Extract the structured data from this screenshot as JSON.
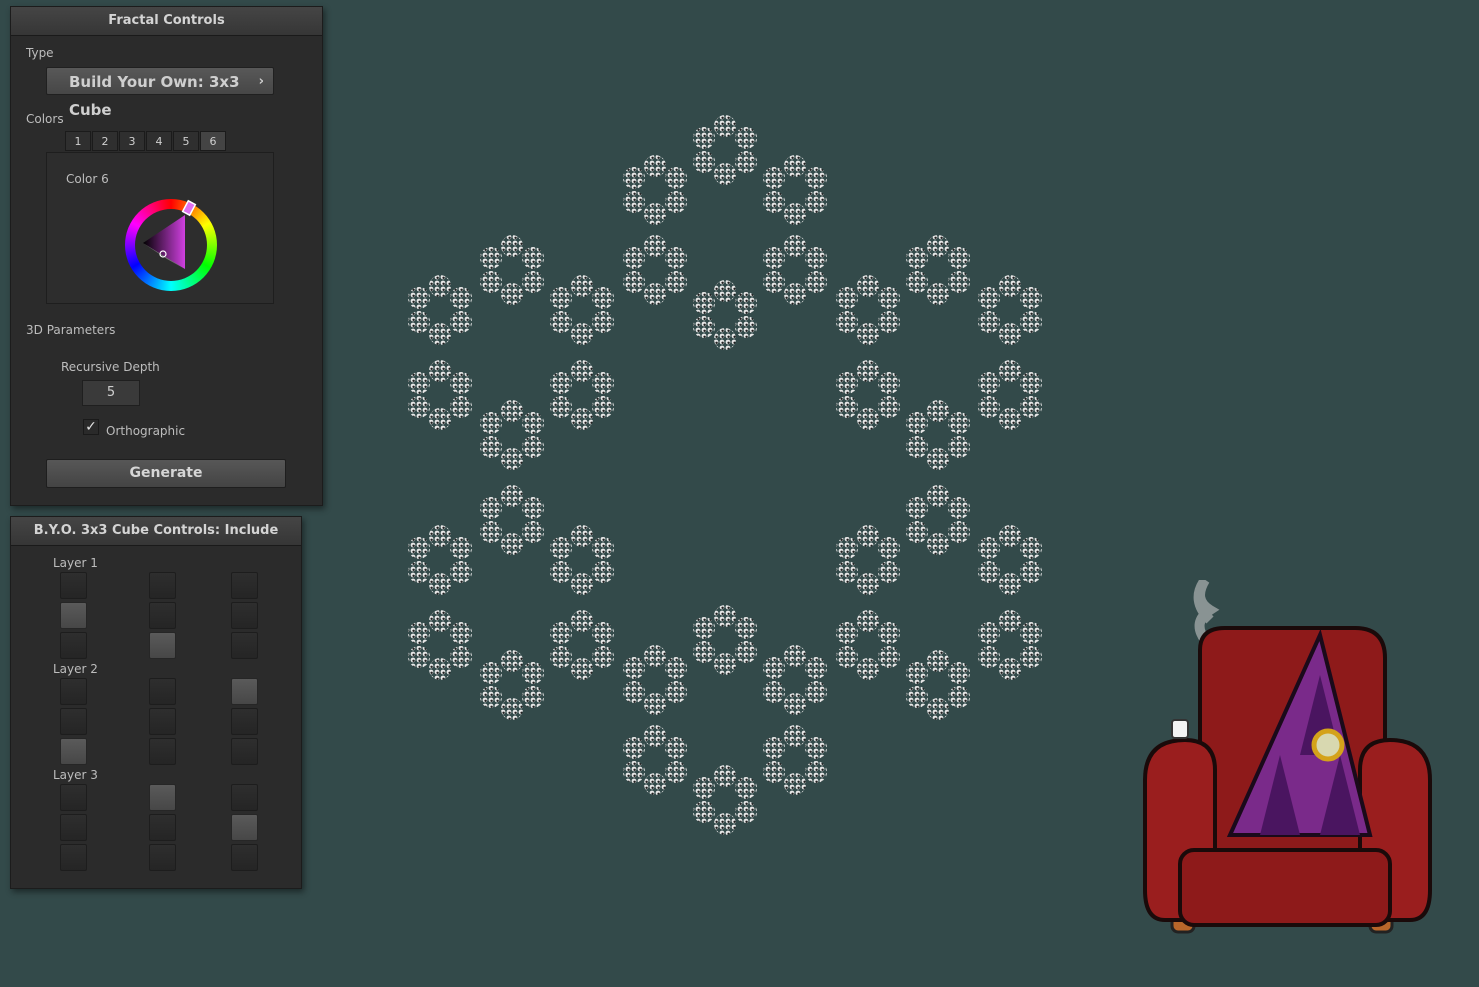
{
  "fractal_controls": {
    "title": "Fractal Controls",
    "type_label": "Type",
    "type_value": "Build Your Own: 3x3 Cube",
    "type_chevron": "›",
    "colors_label": "Colors",
    "color_tabs": [
      "1",
      "2",
      "3",
      "4",
      "5",
      "6"
    ],
    "active_color_tab": "6",
    "color_title": "Color 6",
    "selected_color": "#b03dbb",
    "params_label": "3D Parameters",
    "depth_label": "Recursive Depth",
    "depth_value": "5",
    "ortho_label": "Orthographic",
    "ortho_checked": true,
    "ortho_checkmark": "✓",
    "generate_label": "Generate"
  },
  "cube_controls": {
    "title": "B.Y.O. 3x3 Cube Controls: Include",
    "layers": [
      {
        "label": "Layer 1",
        "grid": [
          [
            0,
            0,
            0
          ],
          [
            1,
            0,
            0
          ],
          [
            0,
            1,
            0
          ]
        ]
      },
      {
        "label": "Layer 2",
        "grid": [
          [
            0,
            0,
            1
          ],
          [
            0,
            0,
            0
          ],
          [
            1,
            0,
            0
          ]
        ]
      },
      {
        "label": "Layer 3",
        "grid": [
          [
            0,
            1,
            0
          ],
          [
            0,
            0,
            1
          ],
          [
            0,
            0,
            0
          ]
        ]
      }
    ]
  },
  "colors": {
    "background": "#334a4a",
    "panel": "#2b2b2b",
    "fractal": "#e6e6e6",
    "chair": "#8e1a1a",
    "pyramid": "#7a2a8a"
  }
}
